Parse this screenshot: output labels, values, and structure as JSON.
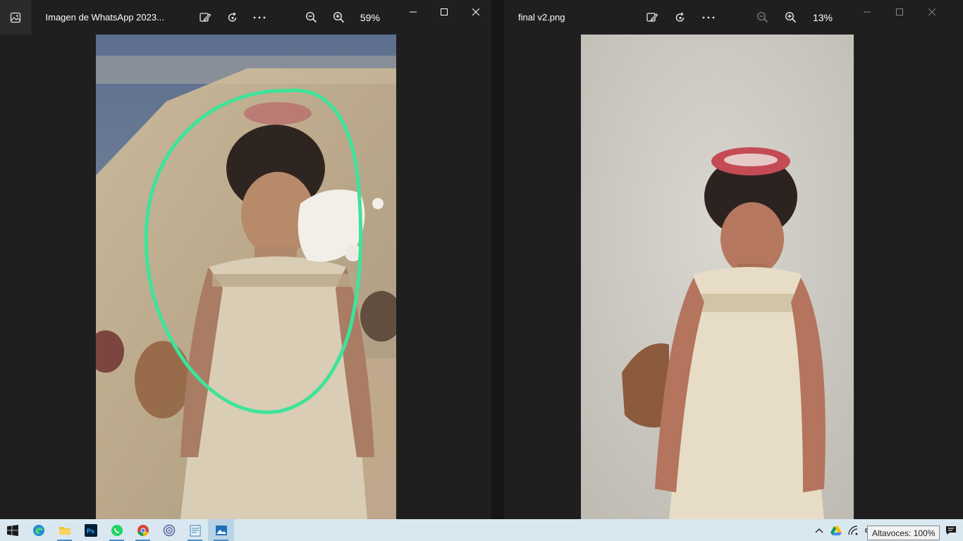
{
  "left_window": {
    "title": "Imagen de WhatsApp 2023...",
    "zoom": "59%",
    "image_subject": "old damaged photo of a girl circled in green"
  },
  "right_window": {
    "title": "final v2.png",
    "zoom": "13%",
    "image_subject": "restored colorized photo of the girl"
  },
  "taskbar": {
    "apps": [
      "windows-start",
      "edge",
      "file-explorer",
      "photoshop",
      "whatsapp",
      "chrome",
      "app-swirl",
      "notepad",
      "photos"
    ],
    "tooltip": "Altavoces: 100%"
  },
  "colors": {
    "window_bg": "#1f1f1f",
    "taskbar_bg": "#d9e7f0",
    "circle_stroke": "#3ee39a"
  }
}
